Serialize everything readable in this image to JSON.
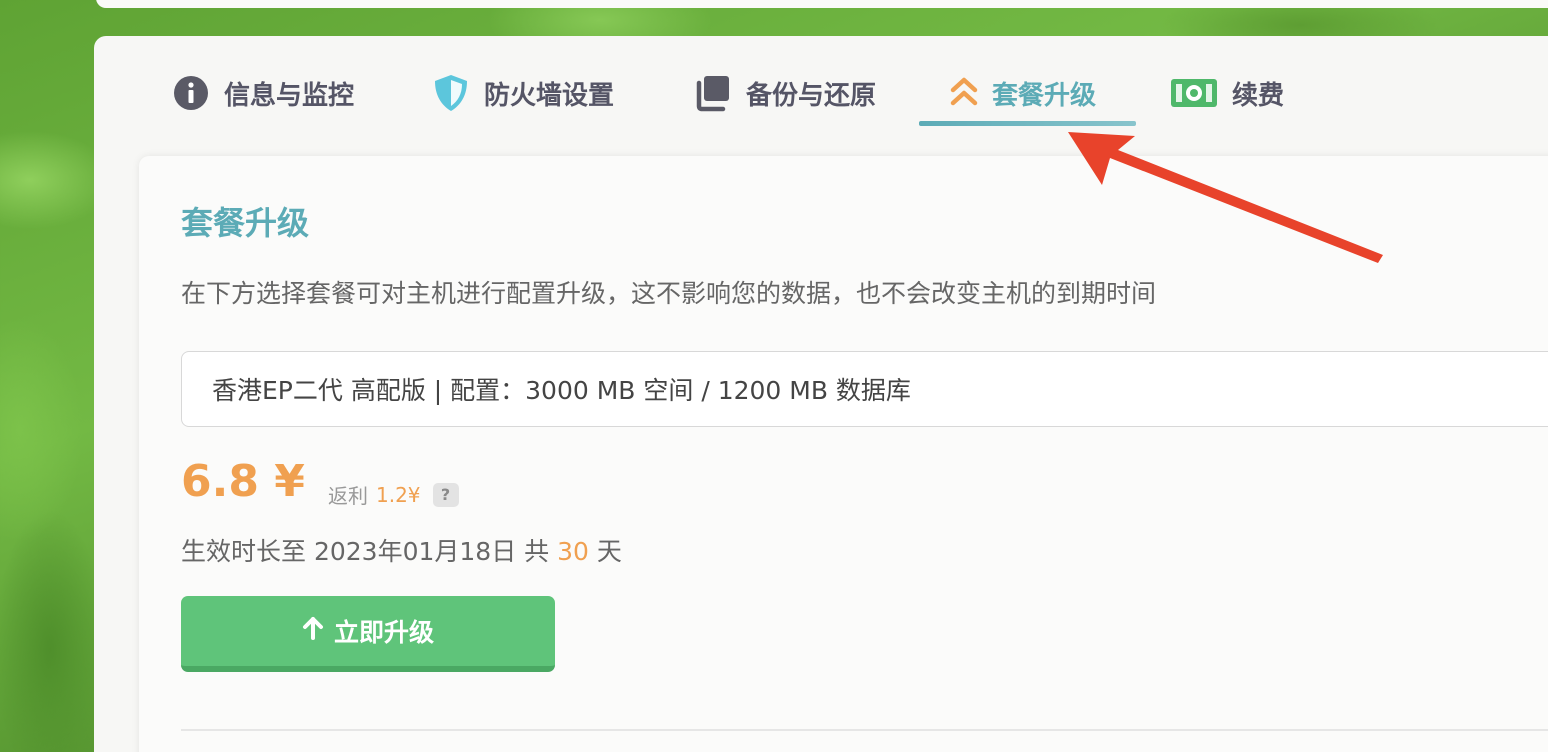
{
  "tabs": [
    {
      "label": "信息与监控",
      "icon": "info-circle-icon",
      "active": false
    },
    {
      "label": "防火墙设置",
      "icon": "shield-icon",
      "active": false
    },
    {
      "label": "备份与还原",
      "icon": "copy-stack-icon",
      "active": false
    },
    {
      "label": "套餐升级",
      "icon": "double-chevron-up-icon",
      "active": true
    },
    {
      "label": "续费",
      "icon": "money-bill-icon",
      "active": false
    }
  ],
  "upgrade": {
    "title": "套餐升级",
    "description": "在下方选择套餐可对主机进行配置升级，这不影响您的数据，也不会改变主机的到期时间",
    "selected_plan": "香港EP二代 高配版 | 配置：3000 MB 空间 / 1200 MB 数据库",
    "price": "6.8 ¥",
    "rebate_label": "返利",
    "rebate_amount": "1.2¥",
    "help_mark": "?",
    "validity_prefix": "生效时长至 2023年01月18日 共",
    "validity_days": "30",
    "validity_suffix": "天",
    "button_label": "立即升级"
  },
  "colors": {
    "accent": "#5cabb6",
    "price": "#f0a050",
    "button": "#5fc47a",
    "annotation_arrow": "#e8432b"
  }
}
